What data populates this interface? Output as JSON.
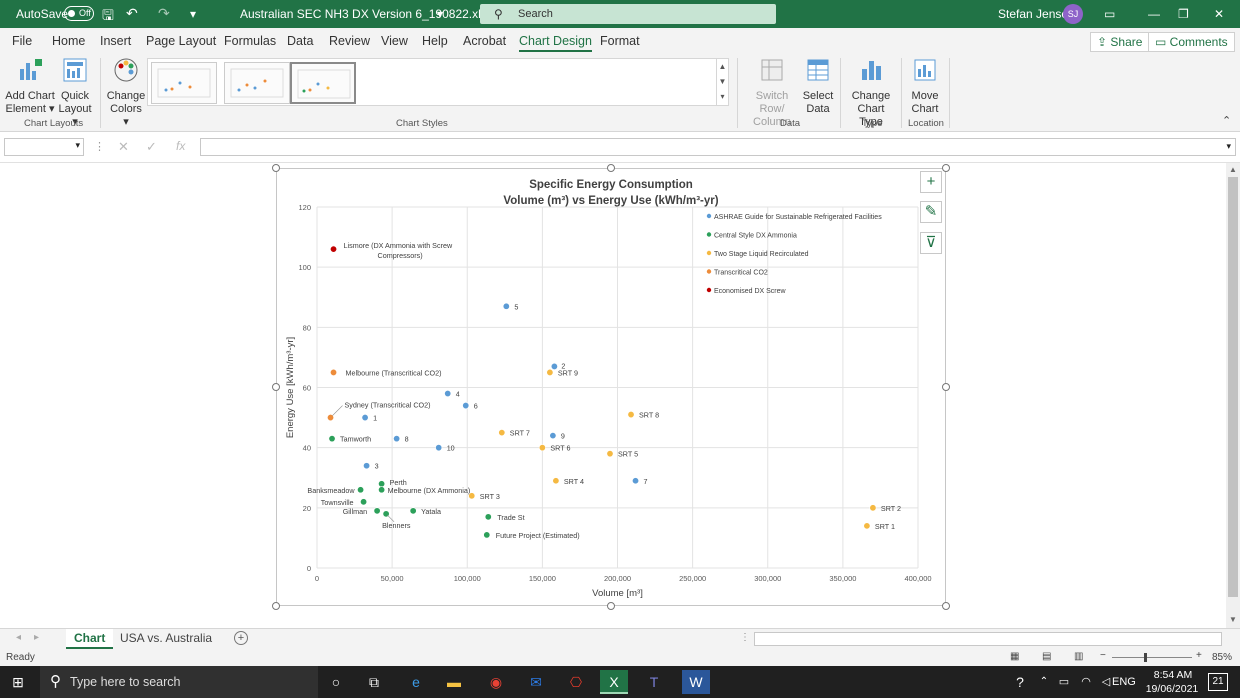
{
  "titlebar": {
    "autosave": "AutoSave",
    "toggle": "Off",
    "filename": "Australian SEC NH3 DX Version 6_190822.xlsx",
    "search": "Search",
    "user": "Stefan Jensen",
    "initials": "SJ"
  },
  "menu": {
    "items": [
      "File",
      "Home",
      "Insert",
      "Page Layout",
      "Formulas",
      "Data",
      "Review",
      "View",
      "Help",
      "Acrobat",
      "Chart Design",
      "Format"
    ],
    "share": "Share",
    "comments": "Comments"
  },
  "ribbon": {
    "add_chart_element": [
      "Add Chart",
      "Element"
    ],
    "quick_layout": [
      "Quick",
      "Layout"
    ],
    "change_colors": [
      "Change",
      "Colors"
    ],
    "switch_row_column": [
      "Switch Row/",
      "Column"
    ],
    "select_data": [
      "Select",
      "Data"
    ],
    "change_chart_type": [
      "Change",
      "Chart Type"
    ],
    "move_chart": [
      "Move",
      "Chart"
    ],
    "groups": {
      "chart_layouts": "Chart Layouts",
      "chart_styles": "Chart Styles",
      "data": "Data",
      "type": "Type",
      "location": "Location"
    }
  },
  "formula_bar": {
    "fx": "fx"
  },
  "chart_data": {
    "type": "scatter",
    "title": [
      "Specific Energy Consumption",
      "Volume (m³) vs Energy Use (kWh/m³-yr)"
    ],
    "xlabel": "Volume [m³]",
    "ylabel": "Energy Use [kWh/m³-yr]",
    "xlim": [
      0,
      400000
    ],
    "ylim": [
      0,
      120
    ],
    "xticks": [
      "0",
      "50,000",
      "100,000",
      "150,000",
      "200,000",
      "250,000",
      "300,000",
      "350,000",
      "400,000"
    ],
    "yticks": [
      "0",
      "20",
      "40",
      "60",
      "80",
      "100",
      "120"
    ],
    "grid": true,
    "legend_position": "top-right",
    "series": [
      {
        "name": "ASHRAE Guide for Sustainable Refrigerated Facilities",
        "color": "#5b9bd5",
        "points": [
          {
            "x": 32000,
            "y": 50,
            "label": "1"
          },
          {
            "x": 158000,
            "y": 67,
            "label": "2"
          },
          {
            "x": 33000,
            "y": 34,
            "label": "3"
          },
          {
            "x": 87000,
            "y": 58,
            "label": "4"
          },
          {
            "x": 126000,
            "y": 87,
            "label": "5"
          },
          {
            "x": 99000,
            "y": 54,
            "label": "6"
          },
          {
            "x": 212000,
            "y": 29,
            "label": "7"
          },
          {
            "x": 53000,
            "y": 43,
            "label": "8"
          },
          {
            "x": 157000,
            "y": 44,
            "label": "9"
          },
          {
            "x": 81000,
            "y": 40,
            "label": "10"
          }
        ]
      },
      {
        "name": "Central Style DX Ammonia",
        "color": "#2ca05a",
        "points": [
          {
            "x": 10000,
            "y": 43,
            "label": "Tamworth"
          },
          {
            "x": 29000,
            "y": 26,
            "label": "Banksmeadow"
          },
          {
            "x": 31000,
            "y": 22,
            "label": "Townsville"
          },
          {
            "x": 40000,
            "y": 19,
            "label": "Gillman"
          },
          {
            "x": 43000,
            "y": 28,
            "label": "Perth"
          },
          {
            "x": 43000,
            "y": 26,
            "label": "Melbourne (DX Ammonia)"
          },
          {
            "x": 46000,
            "y": 18,
            "label": "Blenners"
          },
          {
            "x": 64000,
            "y": 19,
            "label": "Yatala"
          },
          {
            "x": 114000,
            "y": 17,
            "label": "Trade St"
          },
          {
            "x": 113000,
            "y": 11,
            "label": "Future Project (Estimated)"
          }
        ]
      },
      {
        "name": "Two Stage Liquid Recirculated",
        "color": "#f5b942",
        "points": [
          {
            "x": 155000,
            "y": 65,
            "label": "SRT 9"
          },
          {
            "x": 209000,
            "y": 51,
            "label": "SRT 8"
          },
          {
            "x": 123000,
            "y": 45,
            "label": "SRT 7"
          },
          {
            "x": 150000,
            "y": 40,
            "label": "SRT 6"
          },
          {
            "x": 195000,
            "y": 38,
            "label": "SRT 5"
          },
          {
            "x": 159000,
            "y": 29,
            "label": "SRT 4"
          },
          {
            "x": 103000,
            "y": 24,
            "label": "SRT 3"
          },
          {
            "x": 370000,
            "y": 20,
            "label": "SRT 2"
          },
          {
            "x": 366000,
            "y": 14,
            "label": "SRT 1"
          }
        ]
      },
      {
        "name": "Transcritical CO2",
        "color": "#ed8c3a",
        "points": [
          {
            "x": 11000,
            "y": 65,
            "label": "Melbourne (Transcritical CO2)"
          },
          {
            "x": 9000,
            "y": 50,
            "label": "Sydney (Transcritical CO2)"
          }
        ]
      },
      {
        "name": "Economised DX Screw",
        "color": "#c00000",
        "points": [
          {
            "x": 11000,
            "y": 106,
            "label": "Lismore (DX Ammonia with Screw Compressors)"
          }
        ]
      }
    ]
  },
  "tabs": {
    "items": [
      "Chart",
      "USA vs. Australia"
    ],
    "active": "Chart"
  },
  "status": {
    "ready": "Ready",
    "zoom": "85%"
  },
  "taskbar": {
    "search": "Type here to search",
    "time": "8:54 AM",
    "date": "19/06/2021",
    "lang": "ENG",
    "notifications": "21"
  }
}
